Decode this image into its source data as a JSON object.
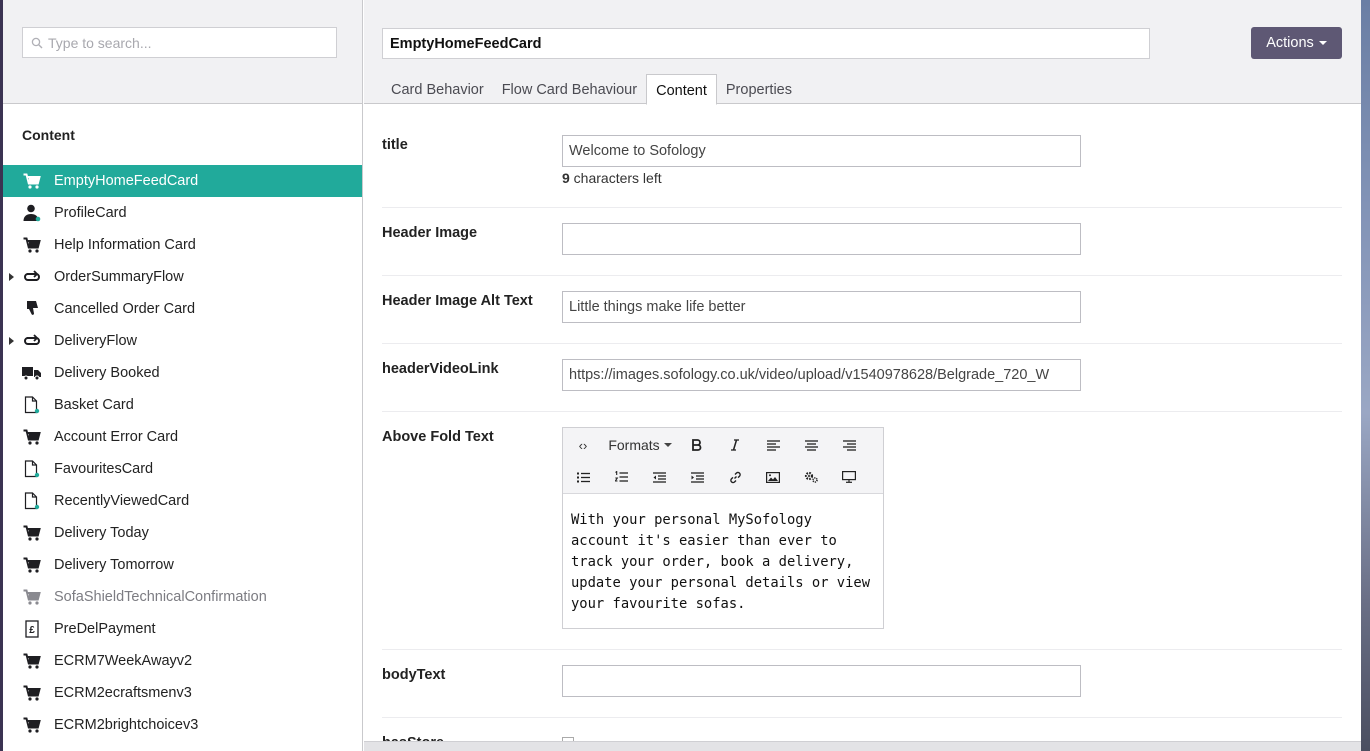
{
  "sidebar": {
    "search_placeholder": "Type to search...",
    "heading": "Content",
    "items": [
      {
        "label": "EmptyHomeFeedCard",
        "icon": "cart-icon",
        "selected": true
      },
      {
        "label": "ProfileCard",
        "icon": "person-icon"
      },
      {
        "label": "Help Information Card",
        "icon": "cart-icon"
      },
      {
        "label": "OrderSummaryFlow",
        "icon": "flow-icon",
        "expandable": true
      },
      {
        "label": "Cancelled Order Card",
        "icon": "thumbs-down-icon"
      },
      {
        "label": "DeliveryFlow",
        "icon": "flow-icon",
        "expandable": true
      },
      {
        "label": "Delivery Booked",
        "icon": "truck-icon"
      },
      {
        "label": "Basket Card",
        "icon": "document-icon"
      },
      {
        "label": "Account Error Card",
        "icon": "cart-icon"
      },
      {
        "label": "FavouritesCard",
        "icon": "document-icon"
      },
      {
        "label": "RecentlyViewedCard",
        "icon": "document-icon"
      },
      {
        "label": "Delivery Today",
        "icon": "cart-icon"
      },
      {
        "label": "Delivery Tomorrow",
        "icon": "cart-icon"
      },
      {
        "label": "SofaShieldTechnicalConfirmation",
        "icon": "cart-icon",
        "dim": true
      },
      {
        "label": "PreDelPayment",
        "icon": "receipt-icon"
      },
      {
        "label": "ECRM7WeekAwayv2",
        "icon": "cart-icon"
      },
      {
        "label": "ECRM2ecraftsmenv3",
        "icon": "cart-icon"
      },
      {
        "label": "ECRM2brightchoicev3",
        "icon": "cart-icon"
      }
    ]
  },
  "header": {
    "name_value": "EmptyHomeFeedCard",
    "actions_label": "Actions",
    "tabs": [
      {
        "label": "Card Behavior"
      },
      {
        "label": "Flow Card Behaviour"
      },
      {
        "label": "Content",
        "active": true
      },
      {
        "label": "Properties"
      }
    ]
  },
  "form": {
    "title": {
      "label": "title",
      "value": "Welcome to Sofology",
      "chars_count": "9",
      "chars_suffix": " characters left"
    },
    "header_image": {
      "label": "Header Image",
      "value": ""
    },
    "header_image_alt": {
      "label": "Header Image Alt Text",
      "value": "Little things make life better"
    },
    "header_video": {
      "label": "headerVideoLink",
      "value": "https://images.sofology.co.uk/video/upload/v1540978628/Belgrade_720_W"
    },
    "above_fold": {
      "label": "Above Fold Text",
      "formats_label": "Formats",
      "text": "With your personal MySofology account it's easier than ever to track your order, book a delivery, update your personal details or view your favourite sofas."
    },
    "body_text": {
      "label": "bodyText",
      "value": ""
    },
    "next_label": "hasStore"
  },
  "colors": {
    "accent": "#21aa9b",
    "actions_button": "#5e5874",
    "left_strip": "#3b3352"
  }
}
